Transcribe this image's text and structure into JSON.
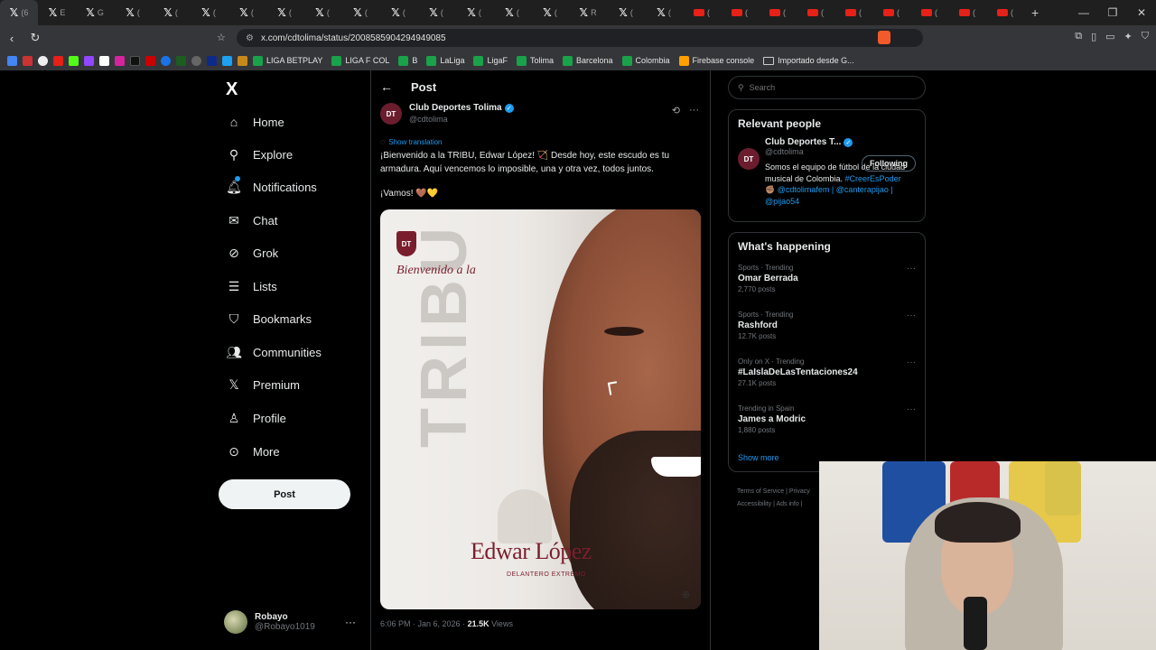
{
  "browser": {
    "tabs": [
      {
        "label": "(6",
        "type": "x"
      },
      {
        "label": "E",
        "type": "x"
      },
      {
        "label": "G",
        "type": "x"
      },
      {
        "label": "(",
        "type": "x"
      },
      {
        "label": "(",
        "type": "x"
      },
      {
        "label": "(",
        "type": "x"
      },
      {
        "label": "(",
        "type": "x"
      },
      {
        "label": "(",
        "type": "x"
      },
      {
        "label": "(",
        "type": "x"
      },
      {
        "label": "(",
        "type": "x"
      },
      {
        "label": "(",
        "type": "x"
      },
      {
        "label": "(",
        "type": "x"
      },
      {
        "label": "(",
        "type": "x"
      },
      {
        "label": "(",
        "type": "x"
      },
      {
        "label": "(",
        "type": "x"
      },
      {
        "label": "R",
        "type": "x"
      },
      {
        "label": "(",
        "type": "x"
      },
      {
        "label": "(",
        "type": "x"
      },
      {
        "label": "(",
        "type": "yt"
      },
      {
        "label": "(",
        "type": "yt"
      },
      {
        "label": "(",
        "type": "yt"
      },
      {
        "label": "(",
        "type": "yt"
      },
      {
        "label": "(",
        "type": "yt"
      },
      {
        "label": "(",
        "type": "yt"
      },
      {
        "label": "(",
        "type": "yt"
      },
      {
        "label": "(",
        "type": "yt"
      },
      {
        "label": "(",
        "type": "yt"
      }
    ],
    "new_tab": "+",
    "url": "x.com/cdtolima/status/2008585904294949085",
    "bookmarks": [
      {
        "label": "LIGA BETPLAY"
      },
      {
        "label": "LIGA F COL"
      },
      {
        "label": "B"
      },
      {
        "label": "LaLiga"
      },
      {
        "label": "LigaF"
      },
      {
        "label": "Tolima"
      },
      {
        "label": "Barcelona"
      },
      {
        "label": "Colombia"
      },
      {
        "label": "Firebase console"
      },
      {
        "label": "Importado desde G..."
      }
    ]
  },
  "nav": {
    "logo": "X",
    "items": [
      {
        "label": "Home",
        "icon": "home-icon"
      },
      {
        "label": "Explore",
        "icon": "search-icon"
      },
      {
        "label": "Notifications",
        "icon": "bell-icon"
      },
      {
        "label": "Chat",
        "icon": "mail-icon"
      },
      {
        "label": "Grok",
        "icon": "grok-icon"
      },
      {
        "label": "Lists",
        "icon": "list-icon"
      },
      {
        "label": "Bookmarks",
        "icon": "bookmark-icon"
      },
      {
        "label": "Communities",
        "icon": "people-icon"
      },
      {
        "label": "Premium",
        "icon": "x-icon"
      },
      {
        "label": "Profile",
        "icon": "person-icon"
      },
      {
        "label": "More",
        "icon": "more-icon"
      }
    ],
    "post_button": "Post",
    "account": {
      "name": "Robayo",
      "handle": "@Robayo1019"
    }
  },
  "post": {
    "header_title": "Post",
    "author_name": "Club Deportes Tolima",
    "author_handle": "@cdtolima",
    "show_translation": "Show translation",
    "text": "¡Bienvenido a la TRIBU, Edwar López! 🏹 Desde hoy, este escudo es tu armadura. Aquí vencemos lo imposible, una y otra vez, todos juntos.",
    "text2": "¡Vamos! 🤎💛",
    "media": {
      "welcome": "Bienvenido a la",
      "tribu": "TRIBU",
      "player_name": "Edwar López",
      "player_position": "DELANTERO EXTREMO"
    },
    "meta_time": "6:06 PM · Jan 6, 2026 · ",
    "meta_views_count": "21.5K",
    "meta_views_label": " Views"
  },
  "right": {
    "search_placeholder": "Search",
    "relevant_title": "Relevant people",
    "relevant": {
      "name": "Club Deportes T...",
      "handle": "@cdtolima",
      "follow_label": "Following",
      "bio_text": "Somos el equipo de fútbol de la ciudad musical de Colombia. ",
      "bio_tag": "#CreerEsPoder",
      "bio_links": "✊🏽 @cdtolimafem | @canterapijao | @pijao54"
    },
    "happening_title": "What's happening",
    "trends": [
      {
        "category": "Sports · Trending",
        "name": "Omar Berrada",
        "count": "2,770 posts"
      },
      {
        "category": "Sports · Trending",
        "name": "Rashford",
        "count": "12.7K posts"
      },
      {
        "category": "Only on X · Trending",
        "name": "#LaIslaDeLasTentaciones24",
        "count": "27.1K posts"
      },
      {
        "category": "Trending in Spain",
        "name": "James a Modric",
        "count": "1,880 posts"
      }
    ],
    "show_more": "Show more",
    "footer_line1": "Terms of Service | Privacy",
    "footer_line2": "Accessibility | Ads info |"
  },
  "colors": {
    "accent": "#1d9bf0",
    "tolima": "#7a1e2e"
  }
}
